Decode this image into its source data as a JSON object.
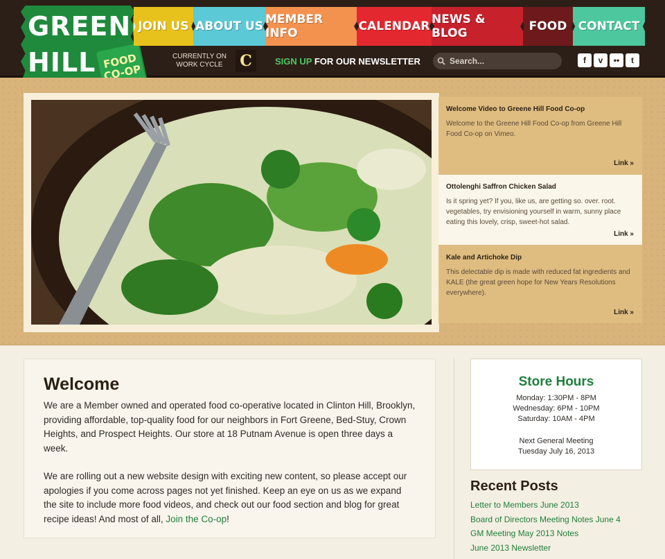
{
  "logo": {
    "line1": "GREENE",
    "line2": "HILL",
    "badge_line1": "FOOD",
    "badge_line2": "CO-OP"
  },
  "nav": [
    {
      "label": "JOIN US",
      "color": "#e8c21c"
    },
    {
      "label": "ABOUT US",
      "color": "#5cc9d6"
    },
    {
      "label": "MEMBER INFO",
      "color": "#f3924f"
    },
    {
      "label": "CALENDAR",
      "color": "#e3282f"
    },
    {
      "label": "NEWS & BLOG",
      "color": "#c7212c"
    },
    {
      "label": "FOOD",
      "color": "#6e1a1c"
    },
    {
      "label": "CONTACT",
      "color": "#4cc79e"
    }
  ],
  "work_cycle": {
    "label_line1": "CURRENTLY ON",
    "label_line2": "WORK CYCLE",
    "value": "C"
  },
  "newsletter": {
    "signup": "SIGN UP",
    "rest": "FOR OUR NEWSLETTER"
  },
  "search": {
    "placeholder": "Search..."
  },
  "social": [
    {
      "icon": "facebook-icon",
      "glyph": "f"
    },
    {
      "icon": "vimeo-icon",
      "glyph": "v"
    },
    {
      "icon": "flickr-icon",
      "glyph": "••"
    },
    {
      "icon": "twitter-icon",
      "glyph": "t"
    }
  ],
  "features": [
    {
      "title": "Welcome Video to Greene Hill Food Co-op",
      "desc": "Welcome to the Greene Hill Food Co-op from Greene Hill Food Co-op on Vimeo.",
      "link": "Link »",
      "active": false
    },
    {
      "title": "Ottolenghi Saffron Chicken Salad",
      "desc": "Is it spring yet? If you, like us, are getting so. over. root. vegetables, try envisioning yourself in warm, sunny place eating this lovely, crisp, sweet-hot salad.",
      "link": "Link »",
      "active": true
    },
    {
      "title": "Kale and Artichoke Dip",
      "desc": "This delectable dip is made with reduced fat ingredients and KALE (the great green hope for New Years Resolutions everywhere).",
      "link": "Link »",
      "active": false
    }
  ],
  "welcome": {
    "title": "Welcome",
    "p1": "We are a Member owned and operated food co-operative located in Clinton Hill, Brooklyn, providing affordable, top-quality food for our neighbors in Fort Greene, Bed-Stuy, Crown Heights, and Prospect Heights. Our store at 18 Putnam Avenue is open three days a week.",
    "p2": "We are rolling out a new website design with exciting new content, so please accept our apologies if you come across pages not yet finished. Keep an eye on us as we expand the site to include more food videos, and check out our food section and blog for great recipe ideas! And most of all,",
    "p2_link": "Join the Co-op",
    "p2_end": "!"
  },
  "store_hours": {
    "title": "Store Hours",
    "lines": [
      "Monday: 1:30PM - 8PM",
      "Wednesday: 6PM - 10PM",
      "Saturday: 10AM - 4PM"
    ],
    "meeting_label": "Next General Meeting",
    "meeting_date": "Tuesday July 16, 2013"
  },
  "recent_posts": {
    "title": "Recent Posts",
    "items": [
      "Letter to Members June 2013",
      "Board of Directors Meeting Notes June 4",
      "GM Meeting May 2013 Notes",
      "June 2013 Newsletter"
    ]
  }
}
